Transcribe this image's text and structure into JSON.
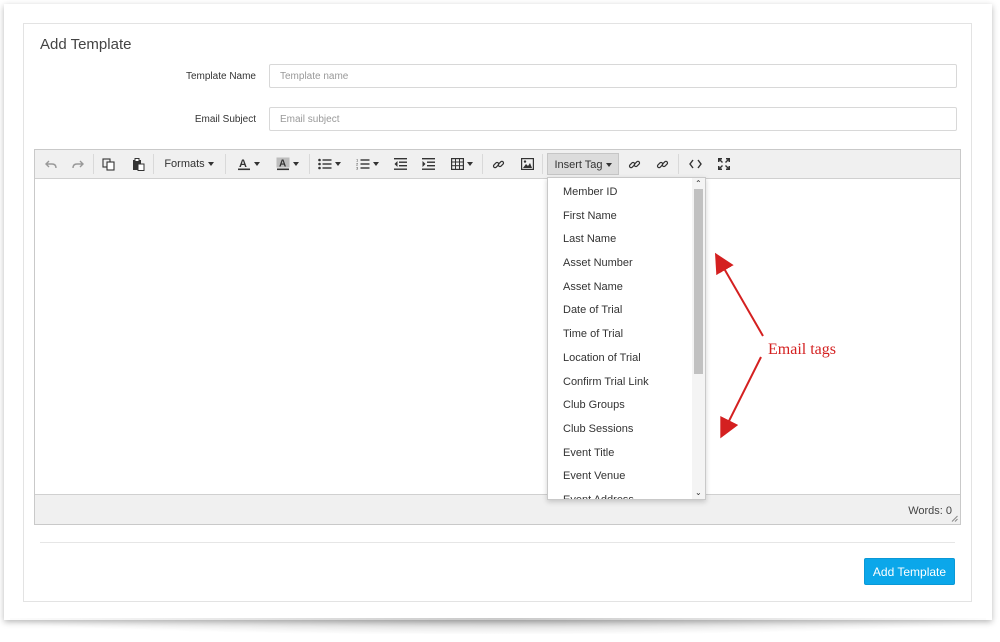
{
  "panel": {
    "title": "Add Template"
  },
  "form": {
    "template_name": {
      "label": "Template Name",
      "value": "",
      "placeholder": "Template name"
    },
    "email_subject": {
      "label": "Email Subject",
      "value": "",
      "placeholder": "Email subject"
    }
  },
  "toolbar": {
    "formats_label": "Formats",
    "insert_tag_label": "Insert Tag",
    "icons": [
      "undo-icon",
      "redo-icon",
      "copy-icon",
      "paste-icon",
      "font-color-icon",
      "background-color-icon",
      "bullet-list-icon",
      "numbered-list-icon",
      "outdent-icon",
      "indent-icon",
      "table-icon",
      "link-icon",
      "image-icon",
      "insert-link-icon",
      "unlink-icon",
      "source-code-icon",
      "fullscreen-icon"
    ]
  },
  "insert_tag_menu": {
    "items": [
      "Member ID",
      "First Name",
      "Last Name",
      "Asset Number",
      "Asset Name",
      "Date of Trial",
      "Time of Trial",
      "Location of Trial",
      "Confirm Trial Link",
      "Club Groups",
      "Club Sessions",
      "Event Title",
      "Event Venue",
      "Event Address"
    ]
  },
  "statusbar": {
    "word_count": "Words: 0"
  },
  "actions": {
    "submit_label": "Add Template"
  },
  "annotation": {
    "text": "Email tags",
    "color": "#d42020"
  },
  "colors": {
    "accent": "#0ba7ea",
    "toolbar_bg": "#f0f0f0"
  }
}
